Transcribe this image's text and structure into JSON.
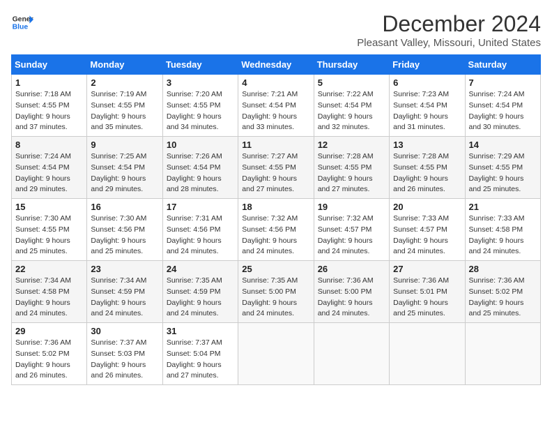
{
  "logo": {
    "line1": "General",
    "line2": "Blue"
  },
  "title": "December 2024",
  "subtitle": "Pleasant Valley, Missouri, United States",
  "weekdays": [
    "Sunday",
    "Monday",
    "Tuesday",
    "Wednesday",
    "Thursday",
    "Friday",
    "Saturday"
  ],
  "weeks": [
    [
      {
        "day": "1",
        "sunrise": "7:18 AM",
        "sunset": "4:55 PM",
        "daylight": "9 hours and 37 minutes."
      },
      {
        "day": "2",
        "sunrise": "7:19 AM",
        "sunset": "4:55 PM",
        "daylight": "9 hours and 35 minutes."
      },
      {
        "day": "3",
        "sunrise": "7:20 AM",
        "sunset": "4:55 PM",
        "daylight": "9 hours and 34 minutes."
      },
      {
        "day": "4",
        "sunrise": "7:21 AM",
        "sunset": "4:54 PM",
        "daylight": "9 hours and 33 minutes."
      },
      {
        "day": "5",
        "sunrise": "7:22 AM",
        "sunset": "4:54 PM",
        "daylight": "9 hours and 32 minutes."
      },
      {
        "day": "6",
        "sunrise": "7:23 AM",
        "sunset": "4:54 PM",
        "daylight": "9 hours and 31 minutes."
      },
      {
        "day": "7",
        "sunrise": "7:24 AM",
        "sunset": "4:54 PM",
        "daylight": "9 hours and 30 minutes."
      }
    ],
    [
      {
        "day": "8",
        "sunrise": "7:24 AM",
        "sunset": "4:54 PM",
        "daylight": "9 hours and 29 minutes."
      },
      {
        "day": "9",
        "sunrise": "7:25 AM",
        "sunset": "4:54 PM",
        "daylight": "9 hours and 29 minutes."
      },
      {
        "day": "10",
        "sunrise": "7:26 AM",
        "sunset": "4:54 PM",
        "daylight": "9 hours and 28 minutes."
      },
      {
        "day": "11",
        "sunrise": "7:27 AM",
        "sunset": "4:55 PM",
        "daylight": "9 hours and 27 minutes."
      },
      {
        "day": "12",
        "sunrise": "7:28 AM",
        "sunset": "4:55 PM",
        "daylight": "9 hours and 27 minutes."
      },
      {
        "day": "13",
        "sunrise": "7:28 AM",
        "sunset": "4:55 PM",
        "daylight": "9 hours and 26 minutes."
      },
      {
        "day": "14",
        "sunrise": "7:29 AM",
        "sunset": "4:55 PM",
        "daylight": "9 hours and 25 minutes."
      }
    ],
    [
      {
        "day": "15",
        "sunrise": "7:30 AM",
        "sunset": "4:55 PM",
        "daylight": "9 hours and 25 minutes."
      },
      {
        "day": "16",
        "sunrise": "7:30 AM",
        "sunset": "4:56 PM",
        "daylight": "9 hours and 25 minutes."
      },
      {
        "day": "17",
        "sunrise": "7:31 AM",
        "sunset": "4:56 PM",
        "daylight": "9 hours and 24 minutes."
      },
      {
        "day": "18",
        "sunrise": "7:32 AM",
        "sunset": "4:56 PM",
        "daylight": "9 hours and 24 minutes."
      },
      {
        "day": "19",
        "sunrise": "7:32 AM",
        "sunset": "4:57 PM",
        "daylight": "9 hours and 24 minutes."
      },
      {
        "day": "20",
        "sunrise": "7:33 AM",
        "sunset": "4:57 PM",
        "daylight": "9 hours and 24 minutes."
      },
      {
        "day": "21",
        "sunrise": "7:33 AM",
        "sunset": "4:58 PM",
        "daylight": "9 hours and 24 minutes."
      }
    ],
    [
      {
        "day": "22",
        "sunrise": "7:34 AM",
        "sunset": "4:58 PM",
        "daylight": "9 hours and 24 minutes."
      },
      {
        "day": "23",
        "sunrise": "7:34 AM",
        "sunset": "4:59 PM",
        "daylight": "9 hours and 24 minutes."
      },
      {
        "day": "24",
        "sunrise": "7:35 AM",
        "sunset": "4:59 PM",
        "daylight": "9 hours and 24 minutes."
      },
      {
        "day": "25",
        "sunrise": "7:35 AM",
        "sunset": "5:00 PM",
        "daylight": "9 hours and 24 minutes."
      },
      {
        "day": "26",
        "sunrise": "7:36 AM",
        "sunset": "5:00 PM",
        "daylight": "9 hours and 24 minutes."
      },
      {
        "day": "27",
        "sunrise": "7:36 AM",
        "sunset": "5:01 PM",
        "daylight": "9 hours and 25 minutes."
      },
      {
        "day": "28",
        "sunrise": "7:36 AM",
        "sunset": "5:02 PM",
        "daylight": "9 hours and 25 minutes."
      }
    ],
    [
      {
        "day": "29",
        "sunrise": "7:36 AM",
        "sunset": "5:02 PM",
        "daylight": "9 hours and 26 minutes."
      },
      {
        "day": "30",
        "sunrise": "7:37 AM",
        "sunset": "5:03 PM",
        "daylight": "9 hours and 26 minutes."
      },
      {
        "day": "31",
        "sunrise": "7:37 AM",
        "sunset": "5:04 PM",
        "daylight": "9 hours and 27 minutes."
      },
      null,
      null,
      null,
      null
    ]
  ]
}
